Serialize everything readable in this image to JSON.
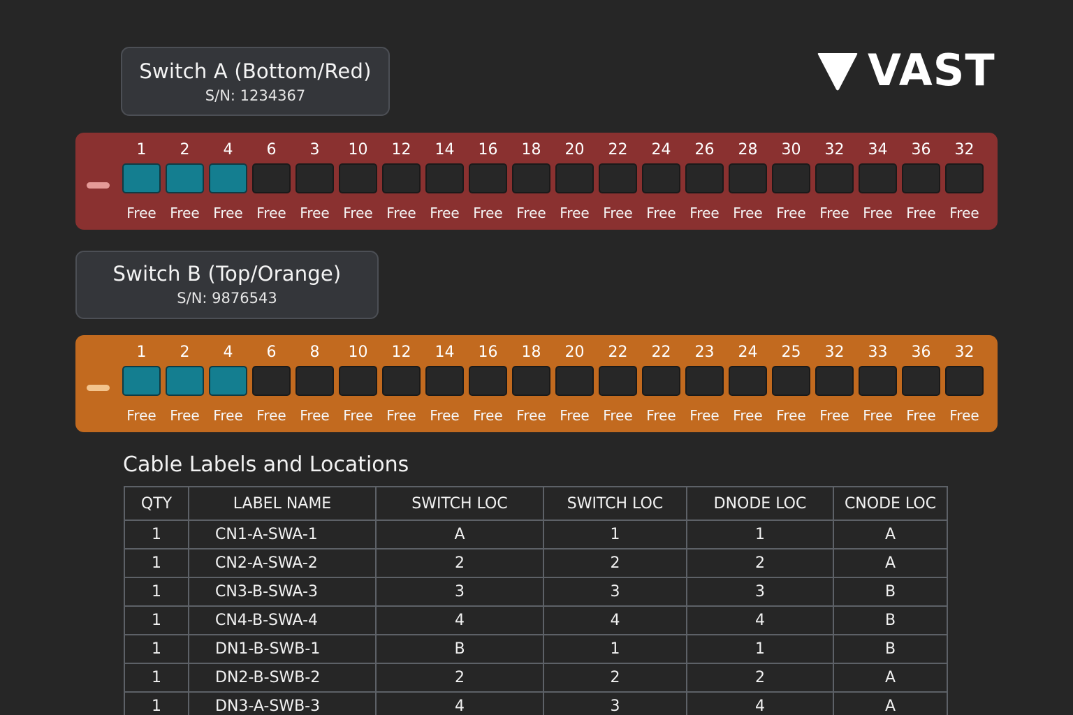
{
  "switch_a": {
    "title": "Switch A (Bottom/Red)",
    "sn": "S/N: 1234367",
    "color": "#8a3130",
    "ports": [
      {
        "num": "1",
        "status": "Free",
        "used": true
      },
      {
        "num": "2",
        "status": "Free",
        "used": true
      },
      {
        "num": "4",
        "status": "Free",
        "used": true
      },
      {
        "num": "6",
        "status": "Free",
        "used": false
      },
      {
        "num": "3",
        "status": "Free",
        "used": false
      },
      {
        "num": "10",
        "status": "Free",
        "used": false
      },
      {
        "num": "12",
        "status": "Free",
        "used": false
      },
      {
        "num": "14",
        "status": "Free",
        "used": false
      },
      {
        "num": "16",
        "status": "Free",
        "used": false
      },
      {
        "num": "18",
        "status": "Free",
        "used": false
      },
      {
        "num": "20",
        "status": "Free",
        "used": false
      },
      {
        "num": "22",
        "status": "Free",
        "used": false
      },
      {
        "num": "24",
        "status": "Free",
        "used": false
      },
      {
        "num": "26",
        "status": "Free",
        "used": false
      },
      {
        "num": "28",
        "status": "Free",
        "used": false
      },
      {
        "num": "30",
        "status": "Free",
        "used": false
      },
      {
        "num": "32",
        "status": "Free",
        "used": false
      },
      {
        "num": "34",
        "status": "Free",
        "used": false
      },
      {
        "num": "36",
        "status": "Free",
        "used": false
      },
      {
        "num": "32",
        "status": "Free",
        "used": false
      }
    ]
  },
  "switch_b": {
    "title": "Switch B (Top/Orange)",
    "sn": "S/N: 9876543",
    "color": "#c26a1f",
    "ports": [
      {
        "num": "1",
        "status": "Free",
        "used": true
      },
      {
        "num": "2",
        "status": "Free",
        "used": true
      },
      {
        "num": "4",
        "status": "Free",
        "used": true
      },
      {
        "num": "6",
        "status": "Free",
        "used": false
      },
      {
        "num": "8",
        "status": "Free",
        "used": false
      },
      {
        "num": "10",
        "status": "Free",
        "used": false
      },
      {
        "num": "12",
        "status": "Free",
        "used": false
      },
      {
        "num": "14",
        "status": "Free",
        "used": false
      },
      {
        "num": "16",
        "status": "Free",
        "used": false
      },
      {
        "num": "18",
        "status": "Free",
        "used": false
      },
      {
        "num": "20",
        "status": "Free",
        "used": false
      },
      {
        "num": "22",
        "status": "Free",
        "used": false
      },
      {
        "num": "22",
        "status": "Free",
        "used": false
      },
      {
        "num": "23",
        "status": "Free",
        "used": false
      },
      {
        "num": "24",
        "status": "Free",
        "used": false
      },
      {
        "num": "25",
        "status": "Free",
        "used": false
      },
      {
        "num": "32",
        "status": "Free",
        "used": false
      },
      {
        "num": "33",
        "status": "Free",
        "used": false
      },
      {
        "num": "36",
        "status": "Free",
        "used": false
      },
      {
        "num": "32",
        "status": "Free",
        "used": false
      }
    ]
  },
  "colors": {
    "used_port": "#147e90",
    "background": "#262626"
  },
  "logo": {
    "text": "VAST",
    "icon": "triangle-logo-icon"
  },
  "cable_table": {
    "title": "Cable Labels and Locations",
    "headers": [
      "QTY",
      "LABEL NAME",
      "SWITCH LOC",
      "SWITCH LOC",
      "DNODE LOC",
      "CNODE LOC"
    ],
    "rows": [
      [
        "1",
        "CN1-A-SWA-1",
        "A",
        "1",
        "1",
        "A"
      ],
      [
        "1",
        "CN2-A-SWA-2",
        "2",
        "2",
        "2",
        "A"
      ],
      [
        "1",
        "CN3-B-SWA-3",
        "3",
        "3",
        "3",
        "B"
      ],
      [
        "1",
        "CN4-B-SWA-4",
        "4",
        "4",
        "4",
        "B"
      ],
      [
        "1",
        "DN1-B-SWB-1",
        "B",
        "1",
        "1",
        "B"
      ],
      [
        "1",
        "DN2-B-SWB-2",
        "2",
        "2",
        "2",
        "A"
      ],
      [
        "1",
        "DN3-A-SWB-3",
        "4",
        "3",
        "4",
        "A"
      ]
    ]
  }
}
